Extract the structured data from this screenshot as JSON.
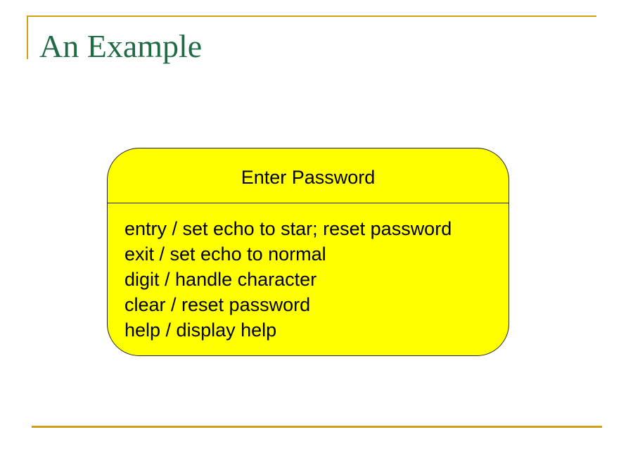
{
  "slide": {
    "title": "An Example",
    "accent_color": "#d4a017",
    "title_color": "#1f6b43"
  },
  "state": {
    "name": "Enter Password",
    "fill_color": "#ffff00",
    "actions": [
      "entry / set echo to star; reset password",
      "exit / set echo to normal",
      "digit / handle character",
      "clear / reset password",
      "help / display help"
    ]
  }
}
